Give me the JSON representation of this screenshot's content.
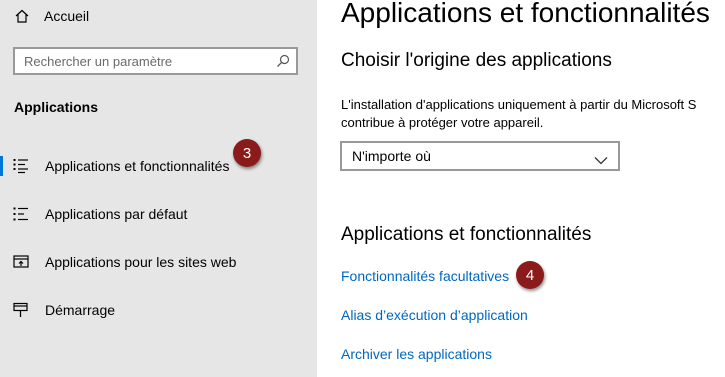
{
  "sidebar": {
    "home_label": "Accueil",
    "search_placeholder": "Rechercher un paramètre",
    "section_title": "Applications",
    "items": [
      {
        "label": "Applications et fonctionnalités",
        "icon": "apps-features-list-icon",
        "active": true
      },
      {
        "label": "Applications par défaut",
        "icon": "default-apps-icon"
      },
      {
        "label": "Applications pour les sites web",
        "icon": "apps-for-websites-icon"
      },
      {
        "label": "Démarrage",
        "icon": "startup-icon"
      }
    ]
  },
  "main": {
    "page_title": "Applications et fonctionnalités",
    "source_heading": "Choisir l'origine des applications",
    "source_description_line1": "L'installation d'applications uniquement à partir du Microsoft S",
    "source_description_line2": "contribue à protéger votre appareil.",
    "source_select_value": "N'importe où",
    "features_heading": "Applications et fonctionnalités",
    "links": [
      "Fonctionnalités facultatives",
      "Alias d’exécution d’application",
      "Archiver les applications"
    ]
  },
  "badges": [
    "3",
    "4"
  ],
  "colors": {
    "accent": "#0078d7",
    "link": "#0067c0",
    "badge": "#8b1a1a",
    "sidebar_bg": "#e6e6e6"
  }
}
